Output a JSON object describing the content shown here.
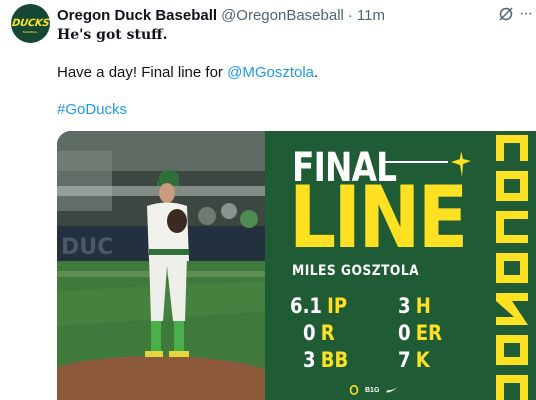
{
  "tweet": {
    "author_name": "Oregon Duck Baseball",
    "handle": "@OregonBaseball",
    "separator": "·",
    "time": "11m",
    "more_glyph": "···",
    "headline": "He's got stuff.",
    "body_prefix": "Have a day! Final line for ",
    "mention": "@MGosztola",
    "body_suffix": ".",
    "hashtag": "#GoDucks"
  },
  "avatar": {
    "text": "DUCKS",
    "sub": "BASEBALL"
  },
  "graphic": {
    "title_top": "FINAL",
    "title_big": "LINE",
    "player_name": "MILES GOSZTOLA",
    "stats": [
      {
        "value": "6.1",
        "label": "IP"
      },
      {
        "value": "3",
        "label": "H"
      },
      {
        "value": "0",
        "label": "R"
      },
      {
        "value": "0",
        "label": "ER"
      },
      {
        "value": "3",
        "label": "BB"
      },
      {
        "value": "7",
        "label": "K"
      }
    ],
    "footer_text": "B1G"
  },
  "colors": {
    "oregon_green": "#154733",
    "oregon_yellow": "#FEE123",
    "link_blue": "#1d9bf0",
    "graphic_green": "#1f5c36"
  }
}
